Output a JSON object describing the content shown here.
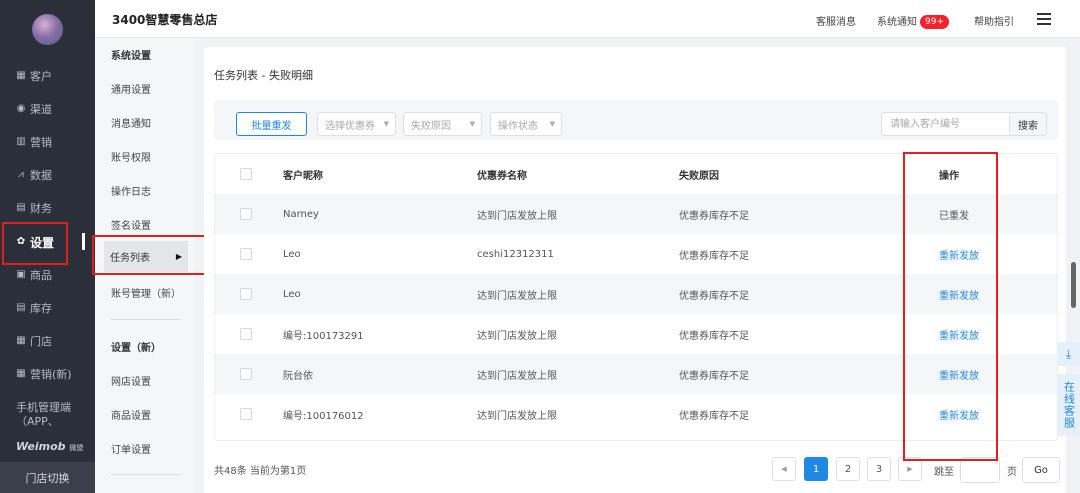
{
  "nav": {
    "items": [
      {
        "label": "客户",
        "icon": "grid-icon"
      },
      {
        "label": "渠道",
        "icon": "compass-icon"
      },
      {
        "label": "营销",
        "icon": "bar-chart-icon"
      },
      {
        "label": "数据",
        "icon": "line-chart-icon"
      },
      {
        "label": "财务",
        "icon": "wallet-icon"
      },
      {
        "label": "设置",
        "icon": "gear-icon",
        "active": true
      },
      {
        "label": "商品",
        "icon": "product-icon"
      },
      {
        "label": "库存",
        "icon": "inventory-icon"
      },
      {
        "label": "门店",
        "icon": "store-icon"
      },
      {
        "label": "营销(新)",
        "icon": "marketing-icon"
      }
    ],
    "mobile_label": "手机管理端（APP、",
    "brand": "Weimob",
    "brand_sub": "微盟",
    "store_switch": "门店切换"
  },
  "header": {
    "store_name": "3400智慧零售总店",
    "service_msg": "客服消息",
    "system_notice": "系统通知",
    "notice_badge": "99+",
    "help": "帮助指引"
  },
  "submenu": {
    "group1": "系统设置",
    "items1": [
      "通用设置",
      "消息通知",
      "账号权限",
      "操作日志",
      "签名设置"
    ],
    "active": "任务列表",
    "account_new": "账号管理（新）",
    "group2": "设置（新）",
    "items2": [
      "网店设置",
      "商品设置",
      "订单设置"
    ]
  },
  "main": {
    "title": "任务列表 - 失败明细",
    "filters": {
      "batch_resend": "批量重发",
      "coupon_select": "选择优惠券",
      "reason_select": "失败原因",
      "status_select": "操作状态",
      "search_placeholder": "请输入客户编号",
      "search_button": "搜索"
    },
    "table": {
      "columns": [
        "客户昵称",
        "优惠券名称",
        "失败原因",
        "操作"
      ],
      "rows": [
        {
          "nickname": "Narney",
          "coupon": "达到门店发放上限",
          "reason": "优惠券库存不足",
          "action": "已重发"
        },
        {
          "nickname": "Leo",
          "coupon": "ceshi12312311",
          "reason": "优惠券库存不足",
          "action": "重新发放"
        },
        {
          "nickname": "Leo",
          "coupon": "达到门店发放上限",
          "reason": "优惠券库存不足",
          "action": "重新发放"
        },
        {
          "nickname": "编号:100173291",
          "coupon": "达到门店发放上限",
          "reason": "优惠券库存不足",
          "action": "重新发放"
        },
        {
          "nickname": "阮台依",
          "coupon": "达到门店发放上限",
          "reason": "优惠券库存不足",
          "action": "重新发放"
        },
        {
          "nickname": "编号:100176012",
          "coupon": "达到门店发放上限",
          "reason": "优惠券库存不足",
          "action": "重新发放"
        }
      ]
    },
    "pagination": {
      "summary": "共48条 当前为第1页",
      "pages": [
        "1",
        "2",
        "3"
      ],
      "current": "1",
      "jump_to": "跳至",
      "page_unit": "页",
      "go": "Go"
    }
  },
  "float": {
    "customer_service": "在线客服"
  },
  "colors": {
    "accent": "#1e88e5",
    "nav_bg": "#2b2f3a",
    "highlight": "#e02020"
  }
}
